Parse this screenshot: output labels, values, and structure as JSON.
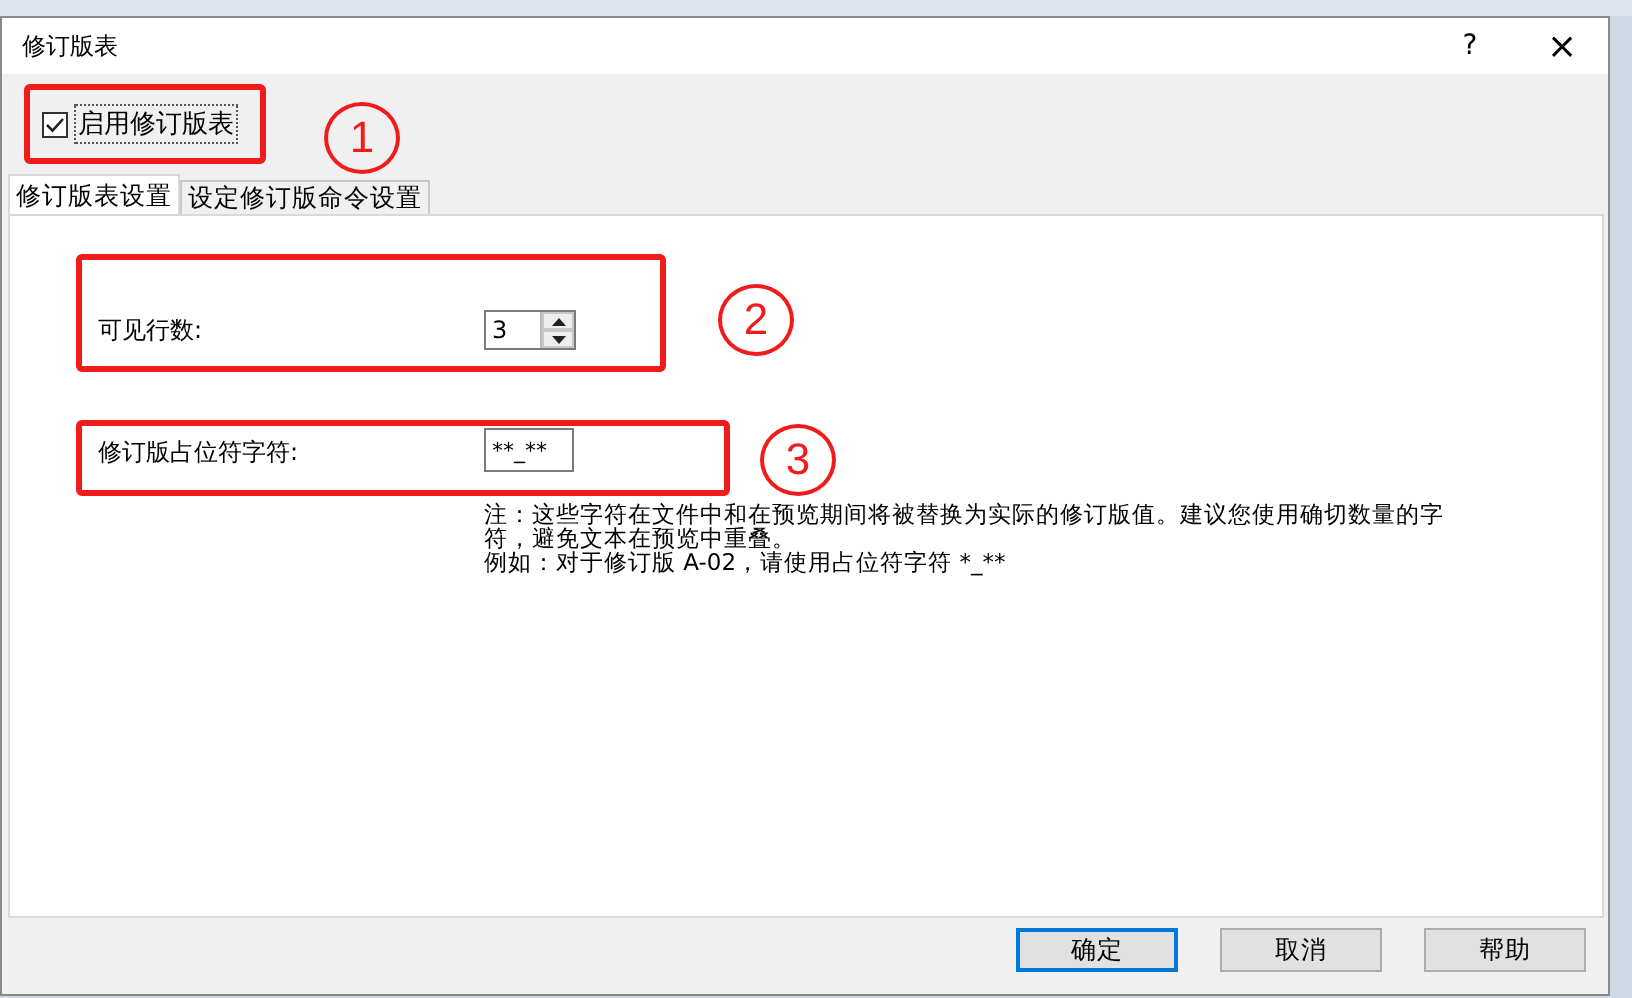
{
  "window": {
    "title": "修订版表",
    "help": "?",
    "close": "×"
  },
  "enable_checkbox": {
    "label": "启用修订版表",
    "checked": true
  },
  "tabs": [
    {
      "label": "修订版表设置",
      "selected": true
    },
    {
      "label": "设定修订版命令设置",
      "selected": false
    }
  ],
  "visible_rows": {
    "label": "可见行数:",
    "value": "3"
  },
  "placeholder_char": {
    "label": "修订版占位符字符:",
    "value": "**_**"
  },
  "notes": [
    "注：这些字符在文件中和在预览期间将被替换为实际的修订版值。建议您使用确切数量的字符，避免文本在预览中重叠。",
    "例如：对于修订版 A-02，请使用占位符字符 *_**"
  ],
  "buttons": [
    {
      "label": "确定",
      "default": true
    },
    {
      "label": "取消",
      "default": false
    },
    {
      "label": "帮助",
      "default": false
    }
  ],
  "annotations": [
    "1",
    "2",
    "3"
  ]
}
